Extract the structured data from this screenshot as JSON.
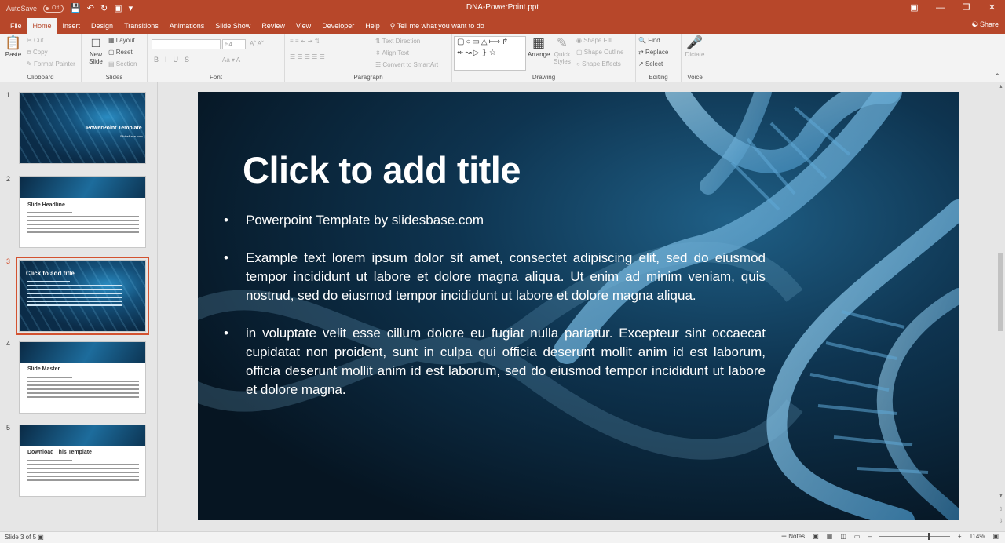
{
  "titlebar": {
    "autosave_label": "AutoSave",
    "autosave_state": "Off",
    "doc_title": "DNA-PowerPoint.ppt",
    "share": "Share"
  },
  "tabs": [
    "File",
    "Home",
    "Insert",
    "Design",
    "Transitions",
    "Animations",
    "Slide Show",
    "Review",
    "View",
    "Developer",
    "Help"
  ],
  "tell_me": "Tell me what you want to do",
  "ribbon": {
    "clipboard": {
      "paste": "Paste",
      "cut": "Cut",
      "copy": "Copy",
      "format_painter": "Format Painter",
      "label": "Clipboard"
    },
    "slides": {
      "new_slide": "New Slide",
      "layout": "Layout",
      "reset": "Reset",
      "section": "Section",
      "label": "Slides"
    },
    "font": {
      "size": "54",
      "label": "Font"
    },
    "paragraph": {
      "text_direction": "Text Direction",
      "align_text": "Align Text",
      "convert": "Convert to SmartArt",
      "label": "Paragraph"
    },
    "drawing": {
      "arrange": "Arrange",
      "quick_styles": "Quick Styles",
      "shape_fill": "Shape Fill",
      "shape_outline": "Shape Outline",
      "shape_effects": "Shape Effects",
      "label": "Drawing"
    },
    "editing": {
      "find": "Find",
      "replace": "Replace",
      "select": "Select",
      "label": "Editing"
    },
    "voice": {
      "dictate": "Dictate",
      "label": "Voice"
    }
  },
  "thumbnails": [
    {
      "num": "1",
      "title": "PowerPoint Template",
      "subtitle": "SlidesBase.com"
    },
    {
      "num": "2",
      "title": "Slide Headline"
    },
    {
      "num": "3",
      "title": "Click to add title"
    },
    {
      "num": "4",
      "title": "Slide Master"
    },
    {
      "num": "5",
      "title": "Download This Template"
    }
  ],
  "slide": {
    "title": "Click to add title",
    "bullets": [
      "Powerpoint Template by slidesbase.com",
      "Example text lorem ipsum dolor sit amet, consectet adipiscing elit, sed do eiusmod tempor incididunt ut labore et dolore magna aliqua. Ut enim ad minim veniam, quis nostrud, sed do eiusmod tempor incididunt ut labore et dolore magna aliqua.",
      "in voluptate velit esse cillum dolore eu fugiat nulla pariatur. Excepteur sint occaecat cupidatat non proident, sunt in culpa qui officia deserunt mollit anim id est laborum, officia deserunt mollit anim id est laborum, sed do eiusmod tempor incididunt ut labore et dolore magna."
    ]
  },
  "status": {
    "slide_of": "Slide 3 of 5",
    "notes": "Notes",
    "zoom": "114%"
  }
}
